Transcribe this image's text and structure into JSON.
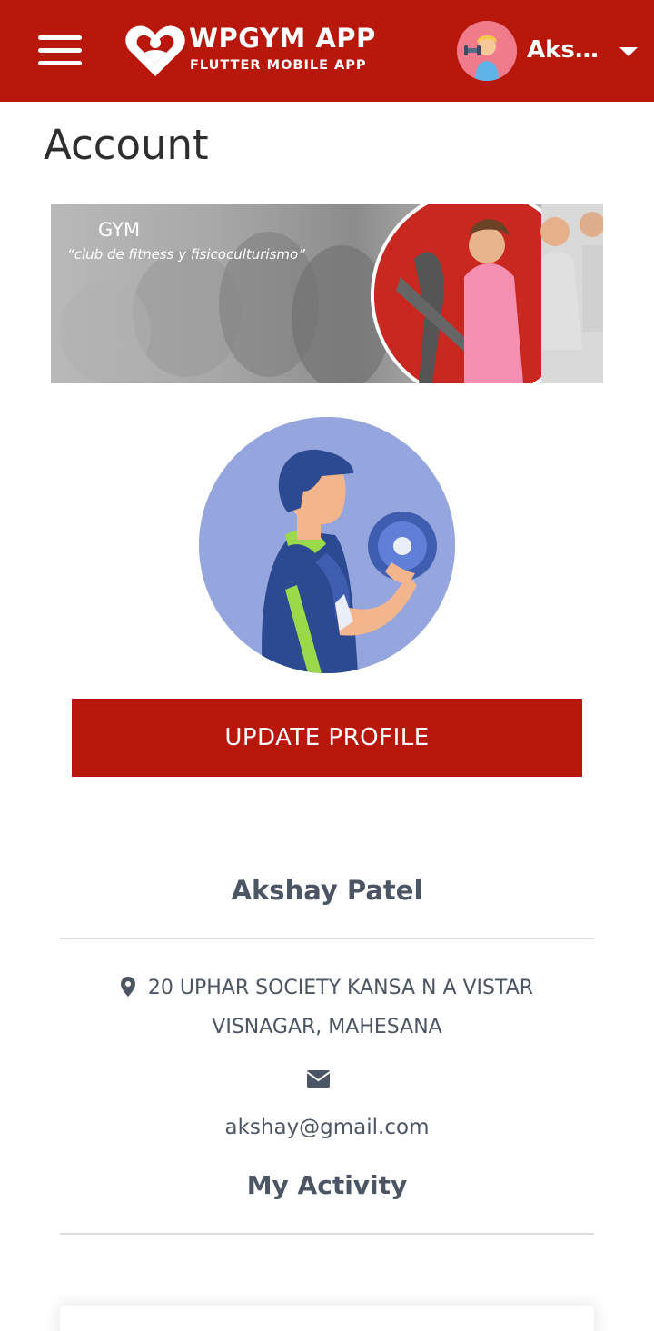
{
  "appbar": {
    "brand_title": "WPGYM APP",
    "brand_subtitle": "FLUTTER MOBILE APP",
    "user_short_name": "Aksh...",
    "color": "#b8170c"
  },
  "page": {
    "title": "Account"
  },
  "banner": {
    "title": "GYM",
    "tagline": "“club de fitness y fisicoculturismo”"
  },
  "profile": {
    "update_button": "UPDATE PROFILE",
    "name": "Akshay Patel",
    "address": "20 UPHAR SOCIETY KANSA N A VISTAR VISNAGAR, MAHESANA",
    "email": "akshay@gmail.com"
  },
  "activity": {
    "title": "My Activity"
  },
  "icons": {
    "menu": "hamburger-menu-icon",
    "logo": "heart-logo-icon",
    "caret": "caret-down-icon",
    "location": "map-marker-icon",
    "email": "envelope-icon"
  }
}
